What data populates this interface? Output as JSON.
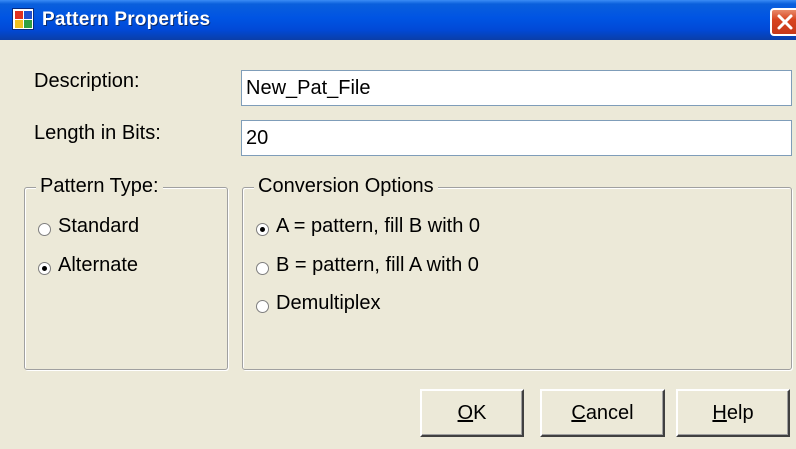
{
  "window": {
    "title": "Pattern Properties",
    "close_label": "close"
  },
  "fields": {
    "description_label": "Description:",
    "description_value": "New_Pat_File",
    "length_label": "Length in Bits:",
    "length_value": "20"
  },
  "pattern_type": {
    "title": "Pattern Type:",
    "options": [
      {
        "label": "Standard",
        "checked": false
      },
      {
        "label": "Alternate",
        "checked": true
      }
    ]
  },
  "conversion_options": {
    "title": "Conversion Options",
    "options": [
      {
        "label": "A = pattern, fill B with 0",
        "checked": true
      },
      {
        "label": "B = pattern, fill A with 0",
        "checked": false
      },
      {
        "label": "Demultiplex",
        "checked": false
      }
    ]
  },
  "buttons": {
    "ok": {
      "mnemonic": "O",
      "rest": "K"
    },
    "cancel": {
      "mnemonic": "C",
      "rest": "ancel"
    },
    "help": {
      "mnemonic": "H",
      "rest": "elp"
    }
  },
  "colors": {
    "titlebar": "#0054e3",
    "face": "#ece9d8",
    "close": "#d8441f"
  }
}
